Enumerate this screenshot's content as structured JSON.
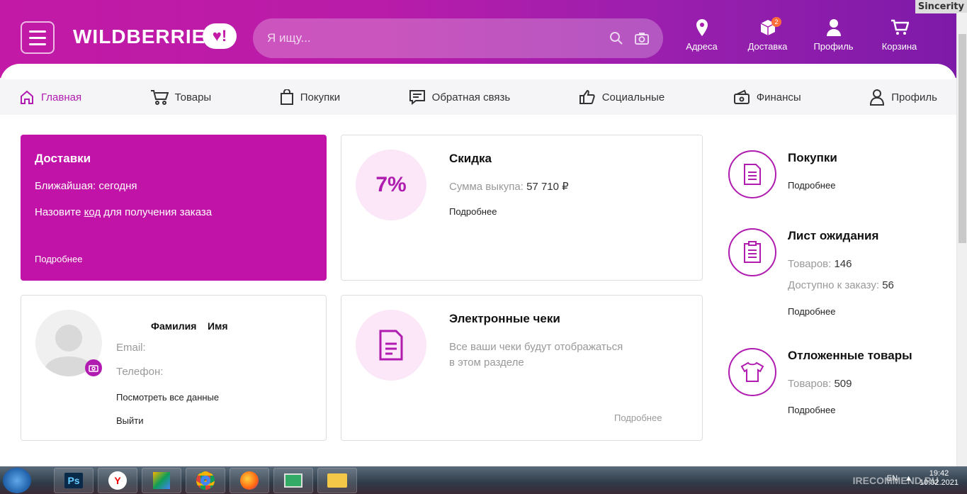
{
  "header": {
    "logo": "WILDBERRIES",
    "logo_heart": "♥!",
    "search_placeholder": "Я ищу...",
    "nav": [
      {
        "label": "Адреса",
        "icon": "location-pin-icon"
      },
      {
        "label": "Доставка",
        "icon": "package-icon",
        "badge": "2"
      },
      {
        "label": "Профиль",
        "icon": "user-icon"
      },
      {
        "label": "Корзина",
        "icon": "cart-icon"
      }
    ],
    "watermark": "Sincerity"
  },
  "tabs": [
    {
      "label": "Главная",
      "icon": "home-icon",
      "active": true
    },
    {
      "label": "Товары",
      "icon": "cart-icon"
    },
    {
      "label": "Покупки",
      "icon": "shopping-bag-icon"
    },
    {
      "label": "Обратная связь",
      "icon": "feedback-icon"
    },
    {
      "label": "Социальные",
      "icon": "thumbs-up-icon"
    },
    {
      "label": "Финансы",
      "icon": "wallet-icon"
    },
    {
      "label": "Профиль",
      "icon": "user-icon"
    }
  ],
  "deliveries": {
    "title": "Доставки",
    "nearest": "Ближайшая: сегодня",
    "code_pre": "Назовите ",
    "code_link": "код",
    "code_post": " для получения заказа",
    "more": "Подробнее"
  },
  "discount": {
    "value": "7%",
    "title": "Скидка",
    "sum_label": "Сумма выкупа:",
    "sum_value": "57 710",
    "currency_glyph": "₽",
    "more": "Подробнее"
  },
  "profile": {
    "surname": "Фамилия",
    "name": "Имя",
    "email_label": "Email:",
    "phone_label": "Телефон:",
    "view_all": "Посмотреть все данные",
    "logout": "Выйти"
  },
  "receipts": {
    "title": "Электронные чеки",
    "text1": "Все ваши чеки будут отображаться",
    "text2": "в этом разделе",
    "more": "Подробнее"
  },
  "side": {
    "purchases": {
      "title": "Покупки",
      "more": "Подробнее"
    },
    "waitlist": {
      "title": "Лист ожидания",
      "items_label": "Товаров:",
      "items_value": "146",
      "available_label": "Доступно к заказу:",
      "available_value": "56",
      "more": "Подробнее"
    },
    "deferred": {
      "title": "Отложенные товары",
      "items_label": "Товаров:",
      "items_value": "509",
      "more": "Подробнее"
    }
  },
  "taskbar": {
    "lang": "EN",
    "time": "19:42",
    "date": "10.02.2021",
    "watermark": "IRECOMMEND.RU",
    "apps": [
      "Ps",
      "Y"
    ]
  },
  "colors": {
    "brand": "#b01cb0",
    "deliveries_bg": "#c213a9"
  }
}
